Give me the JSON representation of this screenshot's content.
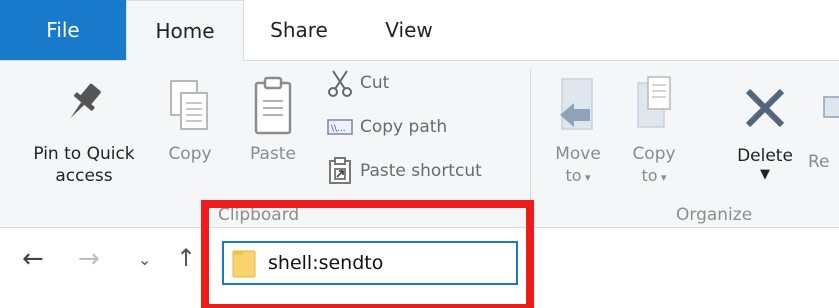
{
  "tabs": {
    "file": "File",
    "home": "Home",
    "share": "Share",
    "view": "View"
  },
  "clipboard": {
    "pin_label_line1": "Pin to Quick",
    "pin_label_line2": "access",
    "copy_label": "Copy",
    "paste_label": "Paste",
    "cut_label": "Cut",
    "copy_path_label": "Copy path",
    "paste_shortcut_label": "Paste shortcut",
    "group_label": "Clipboard"
  },
  "organize": {
    "move_to_line1": "Move",
    "move_to_line2": "to",
    "copy_to_line1": "Copy",
    "copy_to_line2": "to",
    "delete_label": "Delete",
    "rename_label": "Re",
    "group_label": "Organize"
  },
  "address_bar": {
    "value": "shell:sendto"
  },
  "colors": {
    "accent": "#1979ca",
    "highlight": "#ee1c1c",
    "ribbon_bg": "#f5f6f7"
  }
}
